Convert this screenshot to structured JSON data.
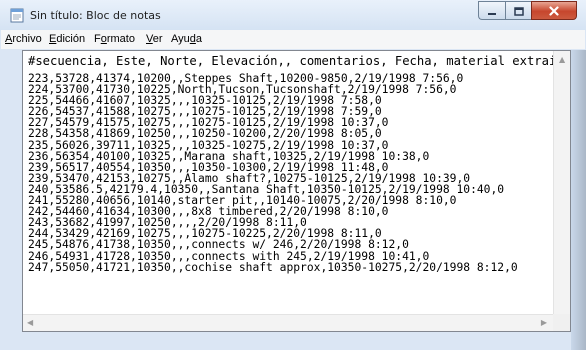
{
  "window": {
    "title": "Sin título: Bloc de notas"
  },
  "menu": {
    "items": [
      "Archivo",
      "Edición",
      "Formato",
      "Ver",
      "Ayuda"
    ]
  },
  "editor": {
    "header": "#secuencia, Este, Norte, Elevación,, comentarios, Fecha, material extraido",
    "lines": [
      "223,53728,41374,10200,,Steppes Shaft,10200-9850,2/19/1998 7:56,0",
      "224,53700,41730,10225,North,Tucson,Tucsonshaft,2/19/1998 7:56,0",
      "225,54466,41607,10325,,,10325-10125,2/19/1998 7:58,0",
      "226,54537,41588,10275,,,10275-10125,2/19/1998 7:59,0",
      "227,54579,41575,10275,,,10275-10125,2/19/1998 10:37,0",
      "228,54358,41869,10250,,,10250-10200,2/20/1998 8:05,0",
      "235,56026,39711,10325,,,10325-10275,2/19/1998 10:37,0",
      "236,56354,40100,10325,,Marana shaft,10325,2/19/1998 10:38,0",
      "239,56517,40554,10350,,,10350-10300,2/19/1998 11:48,0",
      "239,53470,42153,10275,,Alamo shaft?,10275-10125,2/19/1998 10:39,0",
      "240,53586.5,42179.4,10350,,Santana Shaft,10350-10125,2/19/1998 10:40,0",
      "241,55280,40656,10140,starter pit,,10140-10075,2/20/1998 8:10,0",
      "242,54460,41634,10300,,,8x8 timbered,2/20/1998 8:10,0",
      "243,53682,41997,10250,,,,2/20/1998 8:11,0",
      "244,53429,42169,10275,,,10275-10225,2/20/1998 8:11,0",
      "245,54876,41738,10350,,,connects w/ 246,2/20/1998 8:12,0",
      "246,54931,41728,10350,,,connects with 245,2/19/1998 10:41,0",
      "247,55050,41721,10350,,cochise shaft approx,10350-10275,2/20/1998 8:12,0"
    ]
  },
  "icons": {
    "app": "notepad-icon",
    "minimize": "minimize-icon",
    "maximize": "maximize-icon",
    "close": "close-icon"
  },
  "colors": {
    "title_bar": "#dbe6f4",
    "close_button": "#c7462d",
    "text": "#000000",
    "editor_bg": "#ffffff"
  }
}
